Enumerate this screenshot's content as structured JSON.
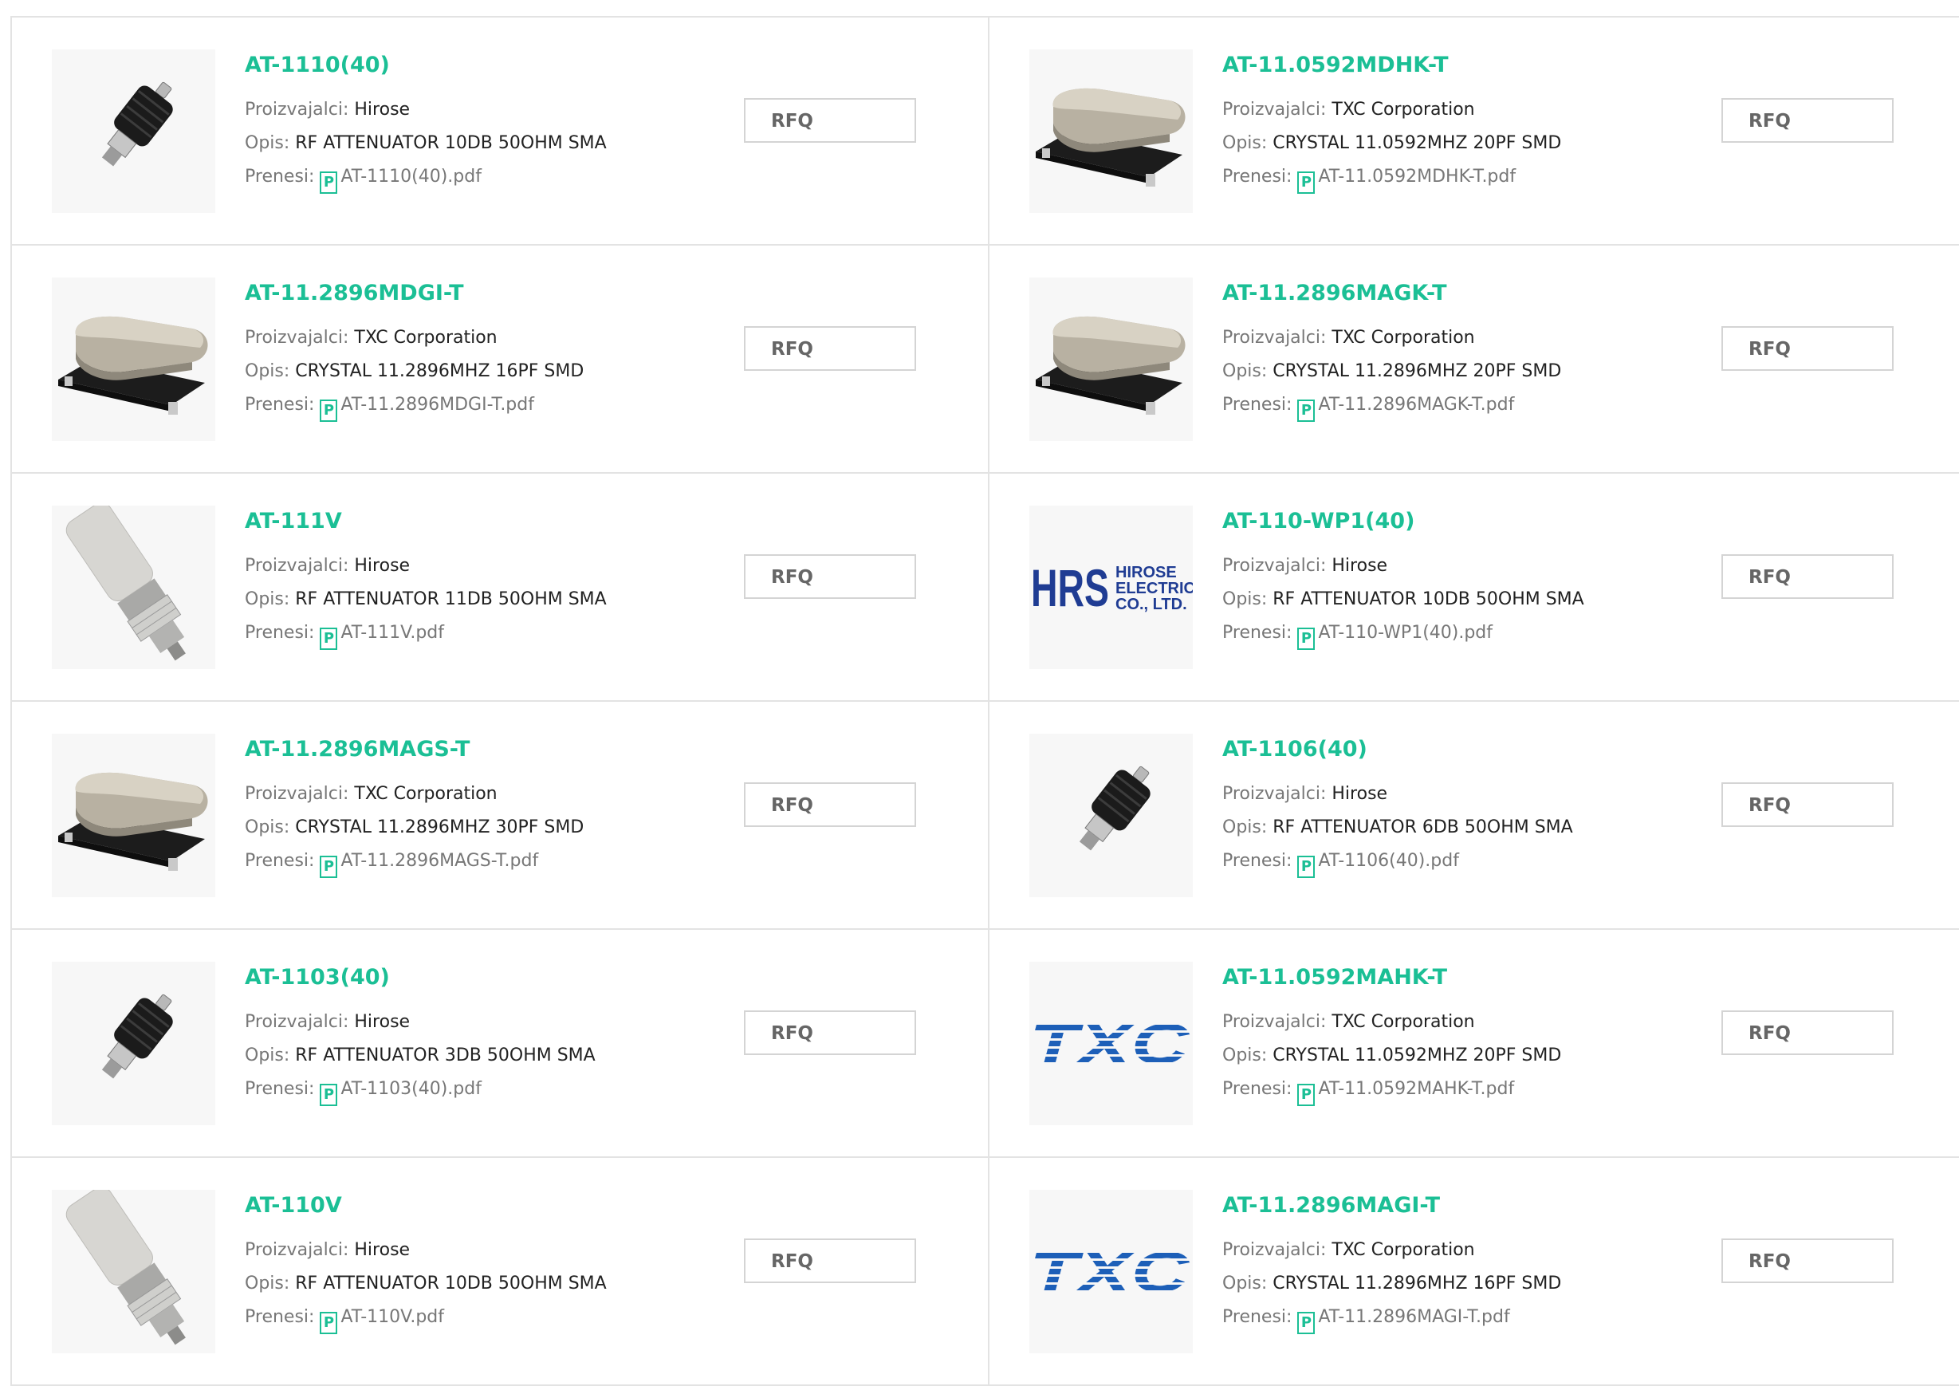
{
  "labels": {
    "manufacturer": "Proizvajalci: ",
    "description": "Opis: ",
    "download": "Prenesi: ",
    "rfq": "RFQ",
    "pdf_icon": "P"
  },
  "products": [
    {
      "part": "AT-1110(40)",
      "manufacturer": "Hirose",
      "description": "RF ATTENUATOR 10DB 50OHM SMA",
      "pdf": "AT-1110(40).pdf",
      "image": "attenuator-small"
    },
    {
      "part": "AT-11.0592MDHK-T",
      "manufacturer": "TXC Corporation",
      "description": "CRYSTAL 11.0592MHZ 20PF SMD",
      "pdf": "AT-11.0592MDHK-T.pdf",
      "image": "crystal-smd"
    },
    {
      "part": "AT-11.2896MDGI-T",
      "manufacturer": "TXC Corporation",
      "description": "CRYSTAL 11.2896MHZ 16PF SMD",
      "pdf": "AT-11.2896MDGI-T.pdf",
      "image": "crystal-smd"
    },
    {
      "part": "AT-11.2896MAGK-T",
      "manufacturer": "TXC Corporation",
      "description": "CRYSTAL 11.2896MHZ 20PF SMD",
      "pdf": "AT-11.2896MAGK-T.pdf",
      "image": "crystal-smd"
    },
    {
      "part": "AT-111V",
      "manufacturer": "Hirose",
      "description": "RF ATTENUATOR 11DB 50OHM SMA",
      "pdf": "AT-111V.pdf",
      "image": "attenuator-large"
    },
    {
      "part": "AT-110-WP1(40)",
      "manufacturer": "Hirose",
      "description": "RF ATTENUATOR 10DB 50OHM SMA",
      "pdf": "AT-110-WP1(40).pdf",
      "image": "hrs-logo"
    },
    {
      "part": "AT-11.2896MAGS-T",
      "manufacturer": "TXC Corporation",
      "description": "CRYSTAL 11.2896MHZ 30PF SMD",
      "pdf": "AT-11.2896MAGS-T.pdf",
      "image": "crystal-smd"
    },
    {
      "part": "AT-1106(40)",
      "manufacturer": "Hirose",
      "description": "RF ATTENUATOR 6DB 50OHM SMA",
      "pdf": "AT-1106(40).pdf",
      "image": "attenuator-small"
    },
    {
      "part": "AT-1103(40)",
      "manufacturer": "Hirose",
      "description": "RF ATTENUATOR 3DB 50OHM SMA",
      "pdf": "AT-1103(40).pdf",
      "image": "attenuator-small"
    },
    {
      "part": "AT-11.0592MAHK-T",
      "manufacturer": "TXC Corporation",
      "description": "CRYSTAL 11.0592MHZ 20PF SMD",
      "pdf": "AT-11.0592MAHK-T.pdf",
      "image": "txc-logo"
    },
    {
      "part": "AT-110V",
      "manufacturer": "Hirose",
      "description": "RF ATTENUATOR 10DB 50OHM SMA",
      "pdf": "AT-110V.pdf",
      "image": "attenuator-large"
    },
    {
      "part": "AT-11.2896MAGI-T",
      "manufacturer": "TXC Corporation",
      "description": "CRYSTAL 11.2896MHZ 16PF SMD",
      "pdf": "AT-11.2896MAGI-T.pdf",
      "image": "txc-logo"
    }
  ],
  "logos": {
    "hrs": {
      "mark": "HRS",
      "line1": "HIROSE",
      "line2": "ELECTRIC",
      "line3": "CO., LTD.",
      "color": "#1f3c93"
    },
    "txc": {
      "mark": "TXC",
      "color": "#1d5fb8"
    }
  },
  "colors": {
    "part_link": "#1bbf95",
    "label": "#777777",
    "value": "#222222",
    "border": "#e3e3e3"
  }
}
